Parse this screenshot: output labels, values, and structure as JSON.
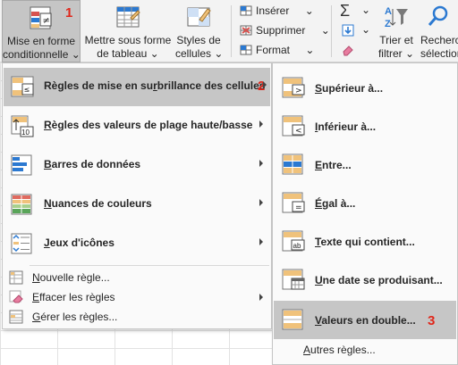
{
  "ribbon": {
    "mise_en_forme_line1": "Mise en forme",
    "mise_en_forme_line2": "conditionnelle",
    "mise_en_forme_chevron": "⌄",
    "mise_en_forme_step": "1",
    "mettre_sous_forme_line1": "Mettre sous forme",
    "mettre_sous_forme_line2": "de tableau",
    "mettre_sous_forme_chevron": "⌄",
    "styles_line1": "Styles de",
    "styles_line2": "cellules",
    "styles_chevron": "⌄",
    "inserer": "Insérer",
    "supprimer": "Supprimer",
    "format": "Format",
    "cell_chevron": "⌄",
    "sigma_chevron": "⌄",
    "fill_chevron": "⌄",
    "trier_line1": "Trier et",
    "trier_line2": "filtrer",
    "trier_chevron": "⌄",
    "rechercher_line1": "Recherch",
    "rechercher_line2": "sélection"
  },
  "menu": {
    "items": [
      {
        "pre": "Règles de mise en su",
        "key": "r",
        "post": "brillance des cellules",
        "step": "2"
      },
      {
        "pre": "",
        "key": "R",
        "post": "ègles des valeurs de plage haute/basse"
      },
      {
        "pre": "",
        "key": "B",
        "post": "arres de données"
      },
      {
        "pre": "",
        "key": "N",
        "post": "uances de couleurs"
      },
      {
        "pre": "",
        "key": "J",
        "post": "eux d'icônes"
      }
    ],
    "small_items": [
      {
        "pre": "",
        "key": "N",
        "post": "ouvelle règle..."
      },
      {
        "pre": "",
        "key": "E",
        "post": "ffacer les règles"
      },
      {
        "pre": "",
        "key": "G",
        "post": "érer les règles..."
      }
    ]
  },
  "submenu": {
    "items": [
      {
        "pre": "",
        "key": "S",
        "post": "upérieur à..."
      },
      {
        "pre": "",
        "key": "I",
        "post": "nférieur à..."
      },
      {
        "pre": "",
        "key": "E",
        "post": "ntre..."
      },
      {
        "pre": "",
        "key": "É",
        "post": "gal à..."
      },
      {
        "pre": "",
        "key": "T",
        "post": "exte qui contient..."
      },
      {
        "pre": "",
        "key": "U",
        "post": "ne date se produisant..."
      },
      {
        "pre": "",
        "key": "V",
        "post": "aleurs en double...",
        "step": "3"
      }
    ],
    "more": {
      "pre": "",
      "key": "A",
      "post": "utres règles..."
    }
  },
  "icons": {
    "cf": "conditional-formatting-icon",
    "table": "format-as-table-icon",
    "styles": "cell-styles-icon",
    "insert": "insert-cells-icon",
    "delete": "delete-cells-icon",
    "format": "format-cells-icon",
    "sum": "autosum-icon",
    "fill": "fill-icon",
    "clear": "clear-icon",
    "sort": "sort-filter-icon",
    "find": "find-select-icon"
  },
  "colors": {
    "step_marker": "#e0271b",
    "selected_bg": "#c6c6c6",
    "accent_blue": "#2b79d1",
    "accent_orange": "#f0c27b"
  }
}
